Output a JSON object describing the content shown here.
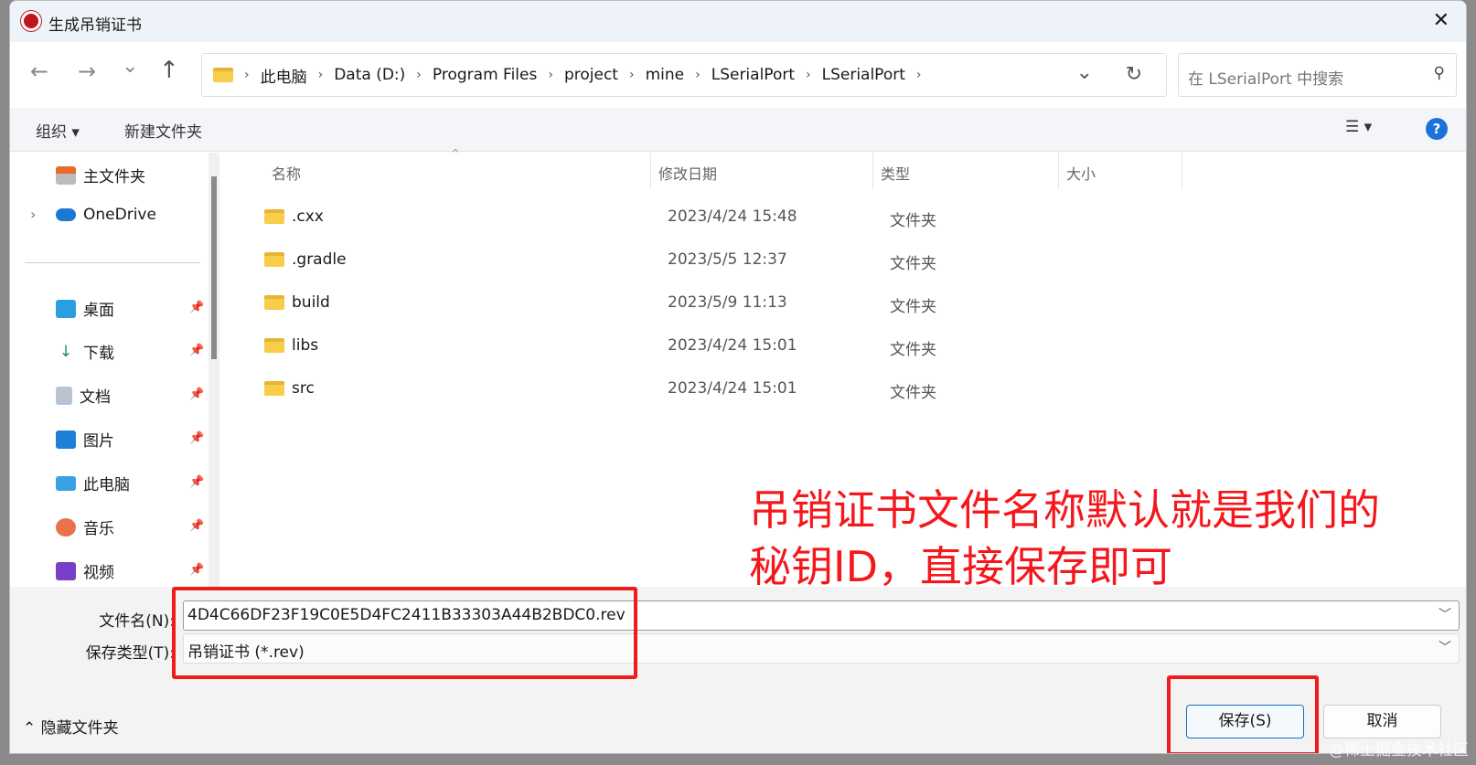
{
  "window": {
    "title": "生成吊销证书",
    "close": "✕"
  },
  "nav": {
    "back": "←",
    "forward": "→",
    "recent": "⌄",
    "up": "↑",
    "refresh": "↻",
    "dropdown": "⌄",
    "breadcrumbs": [
      "此电脑",
      "Data (D:)",
      "Program Files",
      "project",
      "mine",
      "LSerialPort",
      "LSerialPort"
    ],
    "search_placeholder": "在 LSerialPort 中搜索"
  },
  "toolbar": {
    "organize": "组织 ▾",
    "new_folder": "新建文件夹",
    "view": "☰ ▾",
    "help": "?"
  },
  "sidebar": {
    "items": [
      {
        "label": "主文件夹",
        "pinned": false
      },
      {
        "label": "OneDrive",
        "pinned": false
      },
      {
        "label": "桌面",
        "pinned": true
      },
      {
        "label": "下载",
        "pinned": true
      },
      {
        "label": "文档",
        "pinned": true
      },
      {
        "label": "图片",
        "pinned": true
      },
      {
        "label": "此电脑",
        "pinned": true
      },
      {
        "label": "音乐",
        "pinned": true
      },
      {
        "label": "视频",
        "pinned": true
      }
    ]
  },
  "columns": {
    "name": "名称",
    "date": "修改日期",
    "type": "类型",
    "size": "大小"
  },
  "files": [
    {
      "name": ".cxx",
      "date": "2023/4/24 15:48",
      "type": "文件夹"
    },
    {
      "name": ".gradle",
      "date": "2023/5/5 12:37",
      "type": "文件夹"
    },
    {
      "name": "build",
      "date": "2023/5/9 11:13",
      "type": "文件夹"
    },
    {
      "name": "libs",
      "date": "2023/4/24 15:01",
      "type": "文件夹"
    },
    {
      "name": "src",
      "date": "2023/4/24 15:01",
      "type": "文件夹"
    }
  ],
  "annotation": {
    "line1": "吊销证书文件名称默认就是我们的",
    "line2": "秘钥ID，直接保存即可"
  },
  "form": {
    "filename_label": "文件名(N):",
    "filename": "4D4C66DF23F19C0E5D4FC2411B33303A44B2BDC0.rev",
    "filetype_label": "保存类型(T):",
    "filetype": "吊销证书 (*.rev)"
  },
  "footer": {
    "hide_folders": "隐藏文件夹",
    "save": "保存(S)",
    "cancel": "取消"
  },
  "watermark": "@稀土掘金技术社区",
  "colors": {
    "accent": "#1b6fb8",
    "annotation": "#f5171b"
  }
}
